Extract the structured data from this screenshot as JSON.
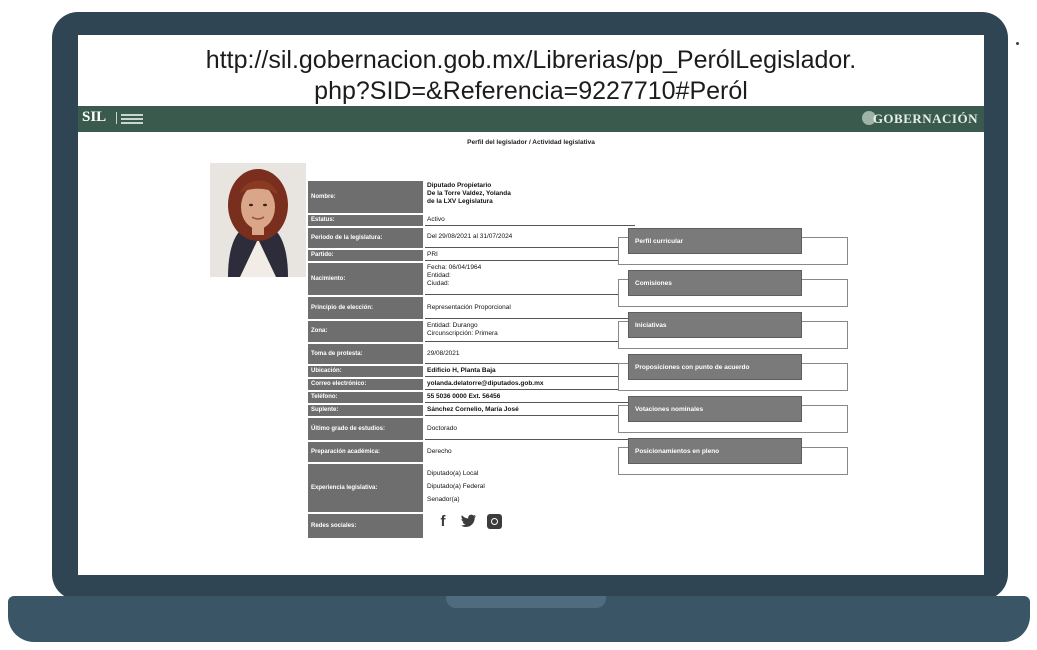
{
  "caption": {
    "url_line1": "http://sil.gobernacion.gob.mx/Librerias/pp_PerólLegislador.",
    "url_line2": "php?SID=&Referencia=9227710#Peról"
  },
  "site": {
    "logo": "SIL",
    "brand": "GOBERNACIÓN",
    "header_color": "#3a5a4e"
  },
  "page_title": "Perfil del legislador / Actividad legislativa",
  "profile": {
    "rows": [
      {
        "label": "Nombre:",
        "value": "Diputado Propietario\nDe la Torre Valdez, Yolanda\nde la LXV Legislatura"
      },
      {
        "label": "Estatus:",
        "value": "Activo"
      },
      {
        "label": "Periodo de la legislatura:",
        "value": "Del 29/08/2021 al 31/07/2024"
      },
      {
        "label": "Partido:",
        "value": "PRI"
      },
      {
        "label": "Nacimiento:",
        "value": "Fecha: 06/04/1964\nEntidad:\nCiudad:"
      },
      {
        "label": "Principio de elección:",
        "value": "Representación Proporcional"
      },
      {
        "label": "Zona:",
        "value": "Entidad: Durango\nCircunscripción: Primera"
      },
      {
        "label": "Toma de protesta:",
        "value": "29/08/2021"
      },
      {
        "label": "Ubicación:",
        "value": "Edificio H, Planta Baja"
      },
      {
        "label": "Correo electrónico:",
        "value": "yolanda.delatorre@diputados.gob.mx"
      },
      {
        "label": "Teléfono:",
        "value": "55 5036 0000 Ext. 56456"
      },
      {
        "label": "Suplente:",
        "value": "Sánchez Cornelio, María José"
      },
      {
        "label": "Último grado de estudios:",
        "value": "Doctorado"
      },
      {
        "label": "Preparación académica:",
        "value": "Derecho"
      },
      {
        "label": "Experiencia legislativa:",
        "value": "Diputado(a) Local\nDiputado(a) Federal\nSenador(a)"
      },
      {
        "label": "Redes sociales:",
        "value": ""
      }
    ]
  },
  "nav": [
    {
      "label": "Perfil curricular"
    },
    {
      "label": "Comisiones"
    },
    {
      "label": "Iniciativas"
    },
    {
      "label": "Proposiciones con punto de acuerdo"
    },
    {
      "label": "Votaciones nominales"
    },
    {
      "label": "Posicionamientos en pleno"
    }
  ],
  "social_icons": [
    "facebook-icon",
    "twitter-icon",
    "instagram-icon"
  ]
}
